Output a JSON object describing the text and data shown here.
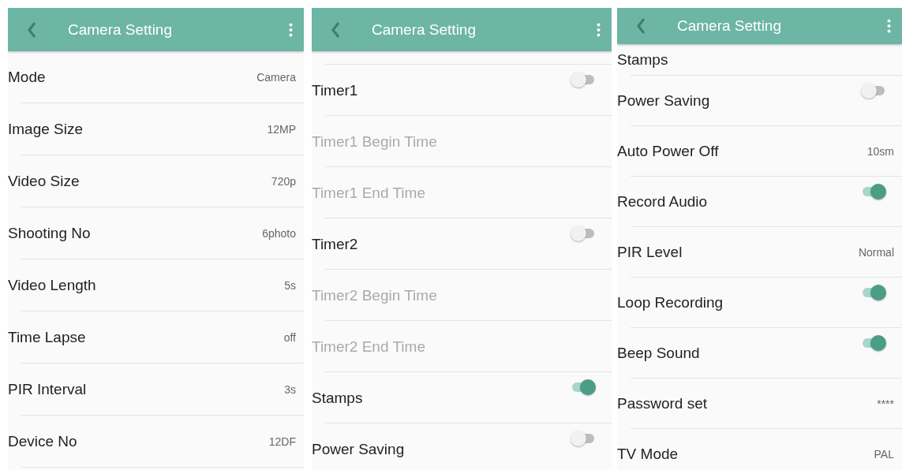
{
  "screens": [
    {
      "title": "Camera Setting",
      "rows": [
        {
          "label": "Mode",
          "kind": "value",
          "value": "Camera",
          "disabled": false
        },
        {
          "label": "Image Size",
          "kind": "value",
          "value": "12MP",
          "disabled": false
        },
        {
          "label": "Video Size",
          "kind": "value",
          "value": "720p",
          "disabled": false
        },
        {
          "label": "Shooting No",
          "kind": "value",
          "value": "6photo",
          "disabled": false
        },
        {
          "label": "Video Length",
          "kind": "value",
          "value": "5s",
          "disabled": false
        },
        {
          "label": "Time Lapse",
          "kind": "value",
          "value": "off",
          "disabled": false
        },
        {
          "label": "PIR Interval",
          "kind": "value",
          "value": "3s",
          "disabled": false
        },
        {
          "label": "Device No",
          "kind": "value",
          "value": "12DF",
          "disabled": false
        }
      ]
    },
    {
      "title": "Camera Setting",
      "rows": [
        {
          "label": "Timer1",
          "kind": "toggle",
          "on": false,
          "disabled": false
        },
        {
          "label": "Timer1 Begin Time",
          "kind": "value",
          "disabled": true
        },
        {
          "label": "Timer1 End Time",
          "kind": "value",
          "disabled": true
        },
        {
          "label": "Timer2",
          "kind": "toggle",
          "on": false,
          "disabled": false
        },
        {
          "label": "Timer2 Begin Time",
          "kind": "value",
          "disabled": true
        },
        {
          "label": "Timer2 End Time",
          "kind": "value",
          "disabled": true
        },
        {
          "label": "Stamps",
          "kind": "toggle",
          "on": true,
          "disabled": false
        },
        {
          "label": "Power Saving",
          "kind": "toggle",
          "on": false,
          "disabled": false
        }
      ]
    },
    {
      "title": "Camera Setting",
      "rows": [
        {
          "label": "Stamps",
          "kind": "value",
          "disabled": false
        },
        {
          "label": "Power Saving",
          "kind": "toggle",
          "on": false,
          "disabled": false
        },
        {
          "label": "Auto Power Off",
          "kind": "value",
          "value": "10sm",
          "disabled": false
        },
        {
          "label": "Record Audio",
          "kind": "toggle",
          "on": true,
          "disabled": false
        },
        {
          "label": "PIR Level",
          "kind": "value",
          "value": "Normal",
          "disabled": false
        },
        {
          "label": "Loop Recording",
          "kind": "toggle",
          "on": true,
          "disabled": false
        },
        {
          "label": "Beep Sound",
          "kind": "toggle",
          "on": true,
          "disabled": false
        },
        {
          "label": "Password set",
          "kind": "value",
          "value": "****",
          "disabled": false
        },
        {
          "label": "TV Mode",
          "kind": "value",
          "value": "PAL",
          "disabled": false
        }
      ]
    }
  ]
}
